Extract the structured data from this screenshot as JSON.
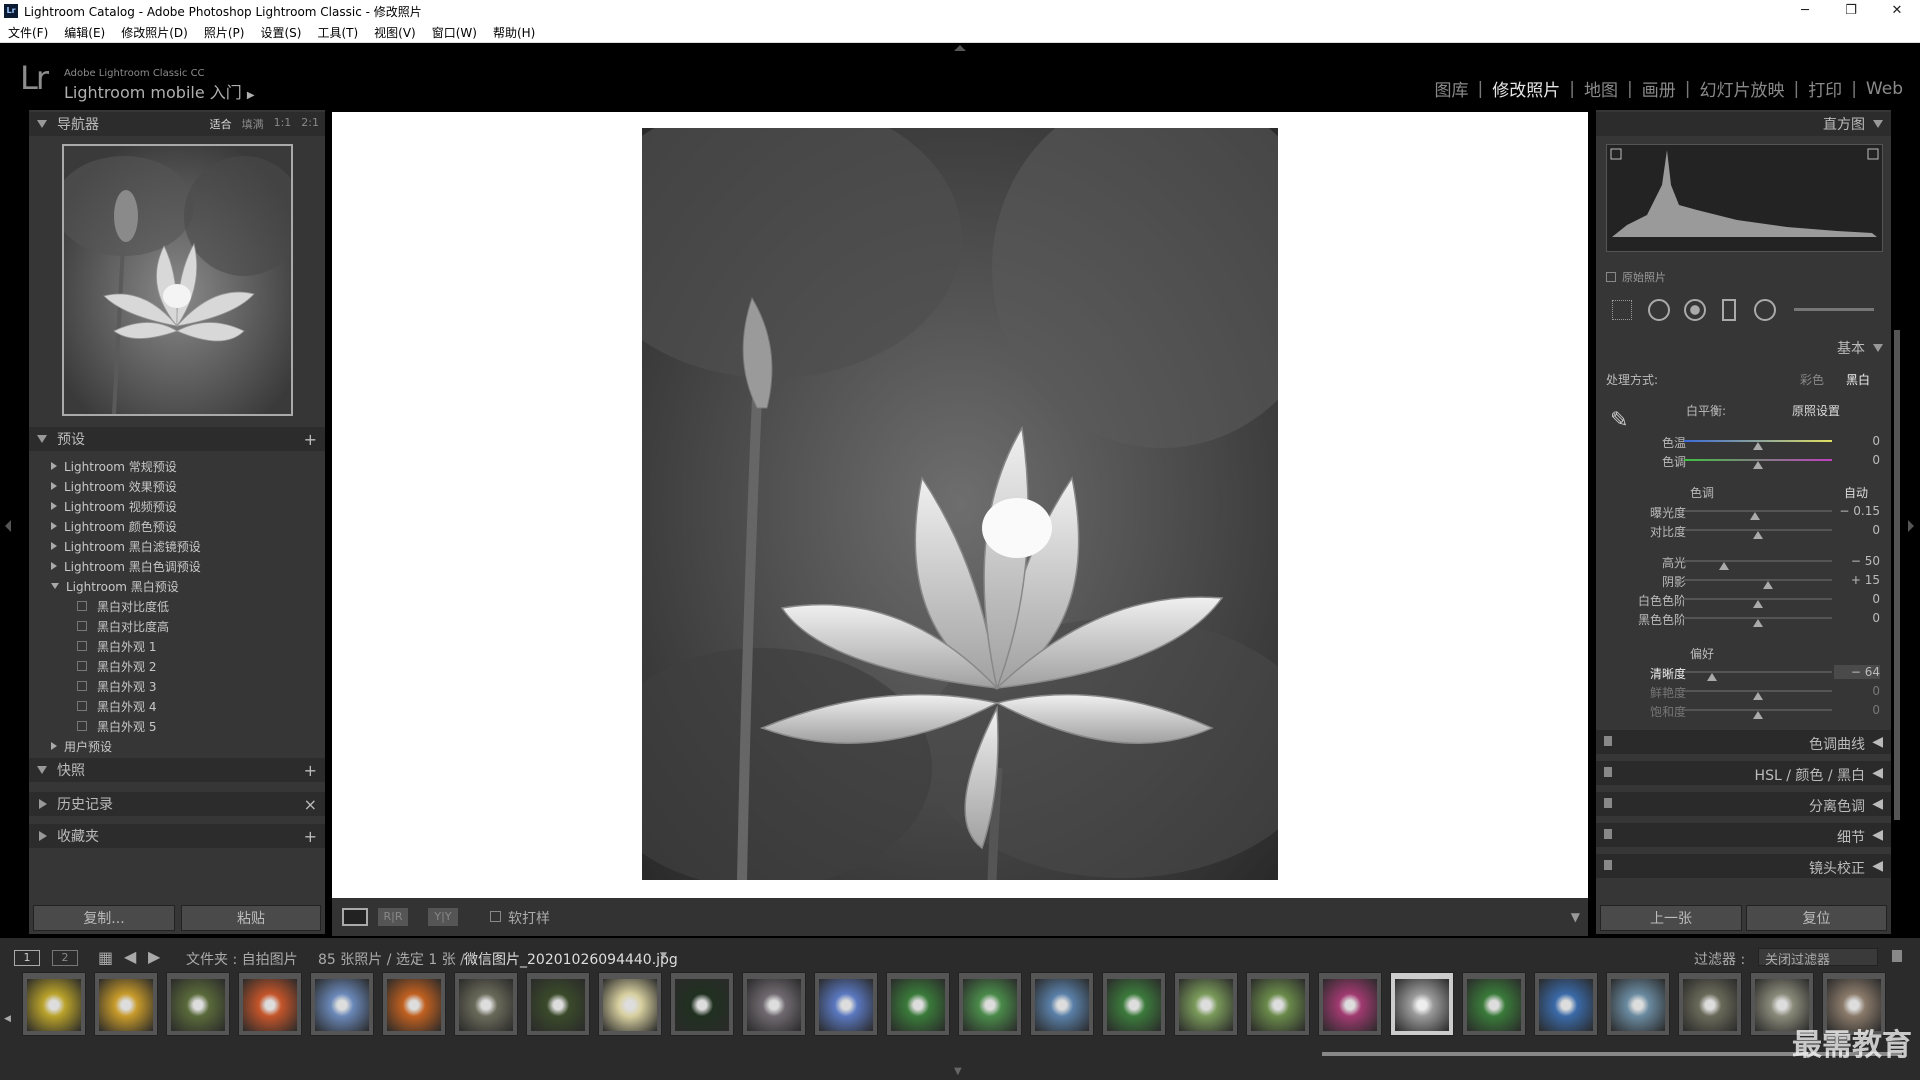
{
  "window": {
    "title": "Lightroom Catalog - Adobe Photoshop Lightroom Classic - 修改照片",
    "minimize": "─",
    "maximize": "❐",
    "close": "✕"
  },
  "menu": [
    "文件(F)",
    "编辑(E)",
    "修改照片(D)",
    "照片(P)",
    "设置(S)",
    "工具(T)",
    "视图(V)",
    "窗口(W)",
    "帮助(H)"
  ],
  "brand": {
    "logo": "Lr",
    "small": "Adobe Lightroom Classic CC",
    "big": "Lightroom mobile 入门"
  },
  "modules": [
    "图库",
    "修改照片",
    "地图",
    "画册",
    "幻灯片放映",
    "打印",
    "Web"
  ],
  "navigator": {
    "title": "导航器",
    "options": [
      "适合",
      "填满",
      "1:1",
      "2:1"
    ]
  },
  "presets": {
    "title": "预设",
    "items": [
      {
        "label": "Lightroom 常规预设",
        "type": "folder"
      },
      {
        "label": "Lightroom 效果预设",
        "type": "folder"
      },
      {
        "label": "Lightroom 视频预设",
        "type": "folder"
      },
      {
        "label": "Lightroom 颜色预设",
        "type": "folder"
      },
      {
        "label": "Lightroom 黑白滤镜预设",
        "type": "folder"
      },
      {
        "label": "Lightroom 黑白色调预设",
        "type": "folder"
      },
      {
        "label": "Lightroom 黑白预设",
        "type": "open"
      },
      {
        "label": "黑白对比度低",
        "type": "preset"
      },
      {
        "label": "黑白对比度高",
        "type": "preset"
      },
      {
        "label": "黑白外观 1",
        "type": "preset"
      },
      {
        "label": "黑白外观 2",
        "type": "preset"
      },
      {
        "label": "黑白外观 3",
        "type": "preset"
      },
      {
        "label": "黑白外观 4",
        "type": "preset"
      },
      {
        "label": "黑白外观 5",
        "type": "preset"
      },
      {
        "label": "用户预设",
        "type": "folder"
      }
    ]
  },
  "left_sections": {
    "snapshots": "快照",
    "history": "历史记录",
    "collections": "收藏夹"
  },
  "left_buttons": {
    "copy": "复制...",
    "paste": "粘贴"
  },
  "toolbar": {
    "softproof": "软打样"
  },
  "right": {
    "histogram_title": "直方图",
    "original_photo": "原始照片",
    "basic_title": "基本",
    "treatment_label": "处理方式:",
    "treatment_color": "彩色",
    "treatment_bw": "黑白",
    "wb_label": "白平衡:",
    "wb_value": "原照设置",
    "tone_label": "色调",
    "tone_auto": "自动",
    "presence_label": "偏好",
    "sliders": [
      {
        "label": "色温",
        "value": "0",
        "pos": 0.5
      },
      {
        "label": "色调",
        "value": "0",
        "pos": 0.5
      },
      {
        "label": "曝光度",
        "value": "− 0.15",
        "pos": 0.48
      },
      {
        "label": "对比度",
        "value": "0",
        "pos": 0.5
      },
      {
        "label": "高光",
        "value": "− 50",
        "pos": 0.27
      },
      {
        "label": "阴影",
        "value": "+ 15",
        "pos": 0.57
      },
      {
        "label": "白色色阶",
        "value": "0",
        "pos": 0.5
      },
      {
        "label": "黑色色阶",
        "value": "0",
        "pos": 0.5
      },
      {
        "label": "清晰度",
        "value": "− 64",
        "pos": 0.19
      },
      {
        "label": "鲜艳度",
        "value": "0",
        "pos": 0.5
      },
      {
        "label": "饱和度",
        "value": "0",
        "pos": 0.5
      }
    ],
    "collapsed": [
      "色调曲线",
      "HSL / 颜色 / 黑白",
      "分离色调",
      "细节",
      "镜头校正"
    ],
    "prev": "上一张",
    "reset": "复位"
  },
  "filmstrip": {
    "pages": [
      "1",
      "2"
    ],
    "path": "文件夹 : 自拍图片",
    "count": "85 张照片 / 选定 1 张 /",
    "filename": "微信图片_20201026094440.jpg",
    "filter_label": "过滤器 :",
    "filter_value": "关闭过滤器",
    "thumb_colors": [
      "#b9a22a",
      "#c79a2a",
      "#5a6a3a",
      "#c4552a",
      "#6a88b8",
      "#c06020",
      "#6a6a5a",
      "#3a4a2a",
      "#d8d0a0",
      "#203020",
      "#706a70",
      "#5a78c0",
      "#3a7a3a",
      "#4a8a4a",
      "#5a80a8",
      "#3c7a3c",
      "#7a9a5a",
      "#6a8a4a",
      "#a03a70",
      "#9a9a9a",
      "#3a7a3a",
      "#3a6aa8",
      "#6a8aa0",
      "#6a6a5a",
      "#8a8a7a",
      "#8a7a6a"
    ]
  },
  "watermark": "最需教育"
}
